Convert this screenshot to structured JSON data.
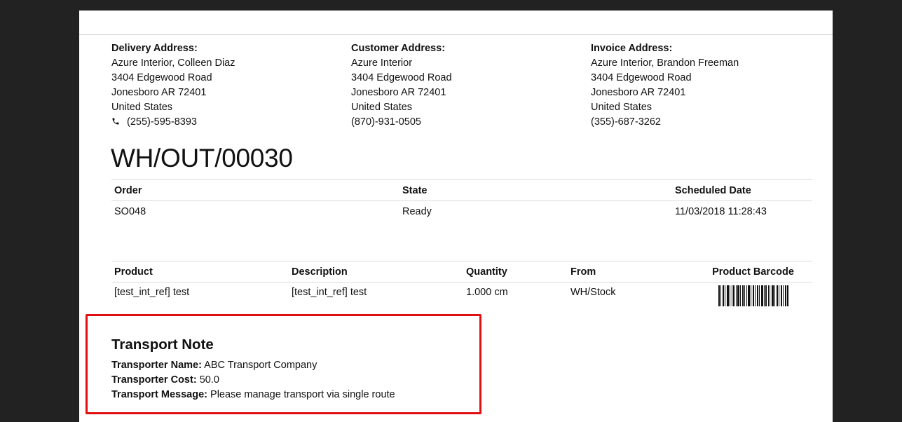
{
  "addresses": {
    "delivery": {
      "heading": "Delivery Address:",
      "name": "Azure Interior, Colleen Diaz",
      "street": "3404 Edgewood Road",
      "city": "Jonesboro AR 72401",
      "country": "United States",
      "phone": "(255)-595-8393",
      "phone_icon": "phone-icon"
    },
    "customer": {
      "heading": "Customer Address:",
      "name": "Azure Interior",
      "street": "3404 Edgewood Road",
      "city": "Jonesboro AR 72401",
      "country": "United States",
      "phone": "(870)-931-0505"
    },
    "invoice": {
      "heading": "Invoice Address:",
      "name": "Azure Interior, Brandon Freeman",
      "street": "3404 Edgewood Road",
      "city": "Jonesboro AR 72401",
      "country": "United States",
      "phone": "(355)-687-3262"
    }
  },
  "document": {
    "title": "WH/OUT/00030"
  },
  "order_table": {
    "headers": [
      "Order",
      "State",
      "Scheduled Date"
    ],
    "row": [
      "SO048",
      "Ready",
      "11/03/2018 11:28:43"
    ]
  },
  "product_table": {
    "headers": [
      "Product",
      "Description",
      "Quantity",
      "From",
      "Product Barcode"
    ],
    "row": [
      "[test_int_ref] test",
      "[test_int_ref] test",
      "1.000 cm",
      "WH/Stock"
    ]
  },
  "transport_note": {
    "title": "Transport Note",
    "name_label": "Transporter Name:",
    "name_value": "ABC Transport Company",
    "cost_label": "Transporter Cost:",
    "cost_value": "50.0",
    "message_label": "Transport Message:",
    "message_value": "Please manage transport via single route",
    "highlight_color": "#e20f12"
  }
}
